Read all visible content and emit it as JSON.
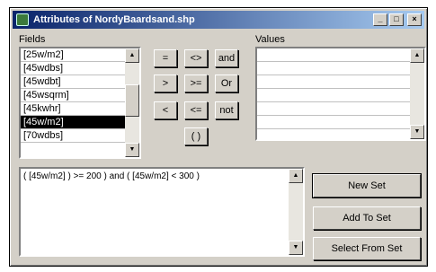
{
  "window": {
    "title": "Attributes of NordyBaardsand.shp",
    "minimize_glyph": "_",
    "maximize_glyph": "□",
    "close_glyph": "×"
  },
  "fields": {
    "label": "Fields",
    "items": [
      "[25w/m2]",
      "[45wdbs]",
      "[45wdbt]",
      "[45wsqrm]",
      "[45kwhr]",
      "[45w/m2]",
      "[70wdbs]"
    ],
    "selected_index": 5
  },
  "values": {
    "label": "Values"
  },
  "operators": {
    "eq": "=",
    "ne": "<>",
    "and": "and",
    "gt": ">",
    "ge": ">=",
    "or": "Or",
    "lt": "<",
    "le": "<=",
    "not": "not",
    "paren": "( )"
  },
  "expression": {
    "text": "( [45w/m2] ) >= 200 ) and ( [45w/m2] < 300 )"
  },
  "buttons": {
    "new_set": "New Set",
    "add_to_set": "Add To Set",
    "select_from_set": "Select From Set"
  },
  "icons": {
    "scroll_up": "up-arrow-icon",
    "scroll_down": "down-arrow-icon"
  }
}
